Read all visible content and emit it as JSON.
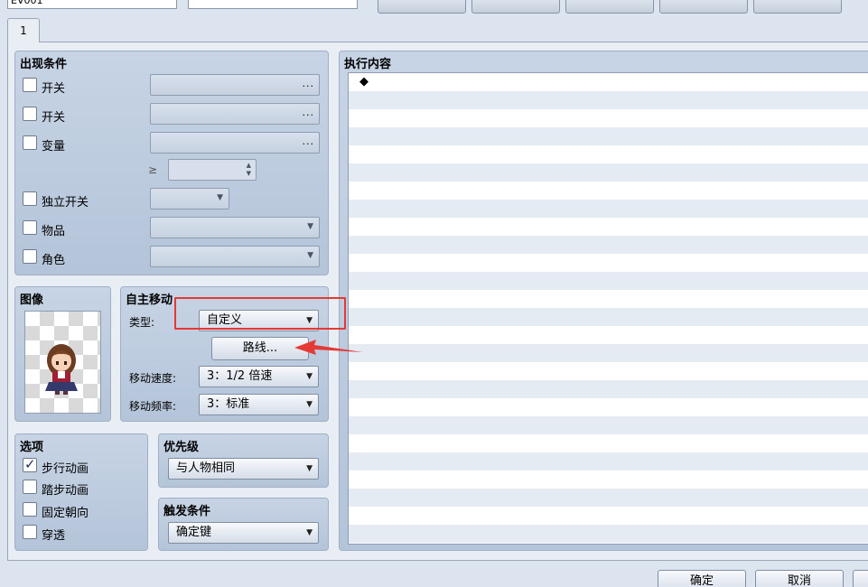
{
  "top": {
    "name_value": "EV001",
    "note_value": ""
  },
  "tabs": [
    {
      "label": "1"
    }
  ],
  "conditions": {
    "title": "出现条件",
    "switch1_label": "开关",
    "switch2_label": "开关",
    "variable_label": "变量",
    "gte_symbol": "≥",
    "self_switch_label": "独立开关",
    "item_label": "物品",
    "actor_label": "角色",
    "dots": "..."
  },
  "image": {
    "title": "图像"
  },
  "autonomous": {
    "title": "自主移动",
    "type_label": "类型:",
    "type_value": "自定义",
    "route_button": "路线...",
    "speed_label": "移动速度:",
    "speed_value": "3：1/2 倍速",
    "freq_label": "移动频率:",
    "freq_value": "3：标准"
  },
  "options": {
    "title": "选项",
    "items": [
      {
        "label": "步行动画",
        "checked": true
      },
      {
        "label": "踏步动画",
        "checked": false
      },
      {
        "label": "固定朝向",
        "checked": false
      },
      {
        "label": "穿透",
        "checked": false
      }
    ]
  },
  "priority": {
    "title": "优先级",
    "value": "与人物相同"
  },
  "trigger": {
    "title": "触发条件",
    "value": "确定键"
  },
  "contents": {
    "title": "执行内容",
    "first_item": "◆"
  },
  "footer": {
    "ok_label": "确定",
    "cancel_label": "取消"
  },
  "colors": {
    "annotation": "#e53935"
  }
}
